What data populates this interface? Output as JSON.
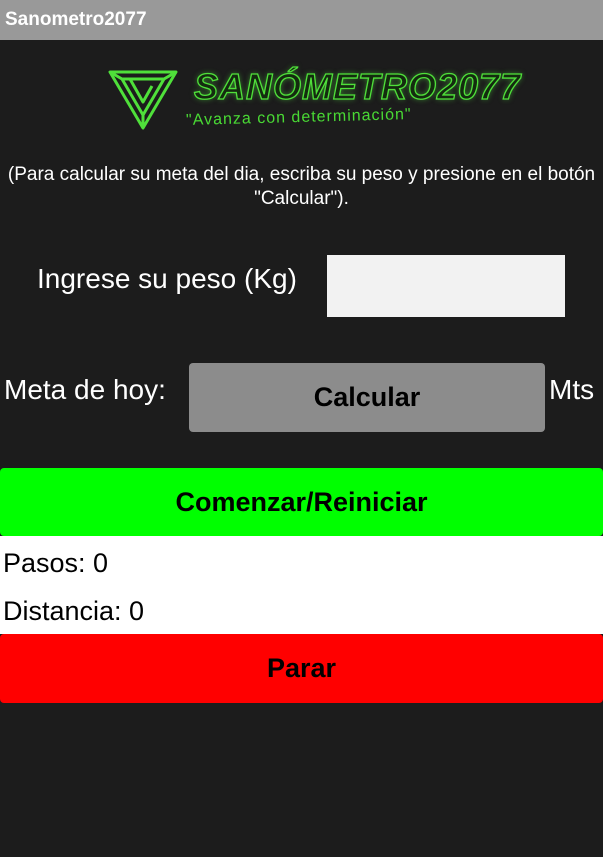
{
  "app": {
    "title": "Sanometro2077"
  },
  "logo": {
    "title": "SANÓMETRO2077",
    "slogan": "\"Avanza con determinación\"",
    "icon": "impossible-triangle-icon",
    "color": "#4fe03a"
  },
  "instructions": "(Para calcular su meta del dia, escriba su peso y presione en el botón \"Calcular\").",
  "weight": {
    "label": "Ingrese su peso (Kg)",
    "value": ""
  },
  "goal": {
    "label": "Meta de hoy:",
    "button_label": "Calcular",
    "unit": "Mts"
  },
  "controls": {
    "start_label": "Comenzar/Reiniciar",
    "start_color": "#00ff00",
    "stop_label": "Parar",
    "stop_color": "#ff0000"
  },
  "stats": {
    "steps": "Pasos: 0",
    "distance": "Distancia: 0"
  }
}
